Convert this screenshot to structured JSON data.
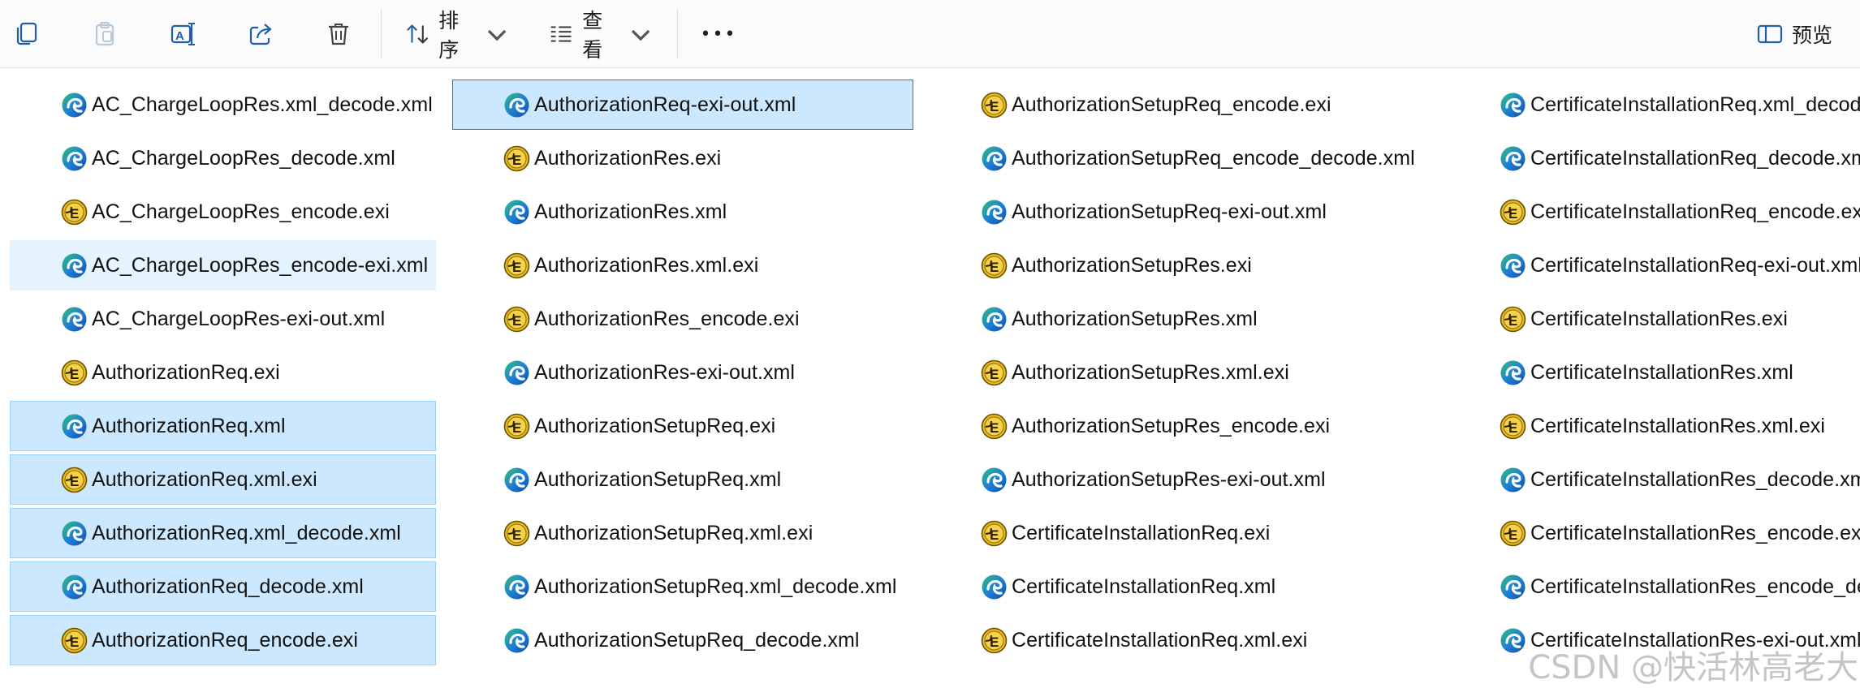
{
  "toolbar": {
    "icons": [
      "copy-icon",
      "paste-icon",
      "rename-icon",
      "share-icon",
      "delete-icon"
    ],
    "sort_label": "排序",
    "view_label": "查看",
    "more_label": "•••",
    "preview_label": "预览"
  },
  "files": {
    "col1": [
      {
        "name": "AC_ChargeLoopRes.xml_decode.xml",
        "type": "xml"
      },
      {
        "name": "AC_ChargeLoopRes_decode.xml",
        "type": "xml"
      },
      {
        "name": "AC_ChargeLoopRes_encode.exi",
        "type": "exi"
      },
      {
        "name": "AC_ChargeLoopRes_encode-exi.xml",
        "type": "xml"
      },
      {
        "name": "AC_ChargeLoopRes-exi-out.xml",
        "type": "xml"
      },
      {
        "name": "AuthorizationReq.exi",
        "type": "exi"
      },
      {
        "name": "AuthorizationReq.xml",
        "type": "xml"
      },
      {
        "name": "AuthorizationReq.xml.exi",
        "type": "exi"
      },
      {
        "name": "AuthorizationReq.xml_decode.xml",
        "type": "xml"
      },
      {
        "name": "AuthorizationReq_decode.xml",
        "type": "xml"
      },
      {
        "name": "AuthorizationReq_encode.exi",
        "type": "exi"
      }
    ],
    "col2": [
      {
        "name": "AuthorizationReq-exi-out.xml",
        "type": "xml"
      },
      {
        "name": "AuthorizationRes.exi",
        "type": "exi"
      },
      {
        "name": "AuthorizationRes.xml",
        "type": "xml"
      },
      {
        "name": "AuthorizationRes.xml.exi",
        "type": "exi"
      },
      {
        "name": "AuthorizationRes_encode.exi",
        "type": "exi"
      },
      {
        "name": "AuthorizationRes-exi-out.xml",
        "type": "xml"
      },
      {
        "name": "AuthorizationSetupReq.exi",
        "type": "exi"
      },
      {
        "name": "AuthorizationSetupReq.xml",
        "type": "xml"
      },
      {
        "name": "AuthorizationSetupReq.xml.exi",
        "type": "exi"
      },
      {
        "name": "AuthorizationSetupReq.xml_decode.xml",
        "type": "xml"
      },
      {
        "name": "AuthorizationSetupReq_decode.xml",
        "type": "xml"
      }
    ],
    "col3": [
      {
        "name": "AuthorizationSetupReq_encode.exi",
        "type": "exi"
      },
      {
        "name": "AuthorizationSetupReq_encode_decode.xml",
        "type": "xml"
      },
      {
        "name": "AuthorizationSetupReq-exi-out.xml",
        "type": "xml"
      },
      {
        "name": "AuthorizationSetupRes.exi",
        "type": "exi"
      },
      {
        "name": "AuthorizationSetupRes.xml",
        "type": "xml"
      },
      {
        "name": "AuthorizationSetupRes.xml.exi",
        "type": "exi"
      },
      {
        "name": "AuthorizationSetupRes_encode.exi",
        "type": "exi"
      },
      {
        "name": "AuthorizationSetupRes-exi-out.xml",
        "type": "xml"
      },
      {
        "name": "CertificateInstallationReq.exi",
        "type": "exi"
      },
      {
        "name": "CertificateInstallationReq.xml",
        "type": "xml"
      },
      {
        "name": "CertificateInstallationReq.xml.exi",
        "type": "exi"
      }
    ],
    "col4": [
      {
        "name": "CertificateInstallationReq.xml_decode.xml",
        "type": "xml"
      },
      {
        "name": "CertificateInstallationReq_decode.xml",
        "type": "xml"
      },
      {
        "name": "CertificateInstallationReq_encode.exi",
        "type": "exi"
      },
      {
        "name": "CertificateInstallationReq-exi-out.xml",
        "type": "xml"
      },
      {
        "name": "CertificateInstallationRes.exi",
        "type": "exi"
      },
      {
        "name": "CertificateInstallationRes.xml",
        "type": "xml"
      },
      {
        "name": "CertificateInstallationRes.xml.exi",
        "type": "exi"
      },
      {
        "name": "CertificateInstallationRes_decode.xml",
        "type": "xml"
      },
      {
        "name": "CertificateInstallationRes_encode.exi",
        "type": "exi"
      },
      {
        "name": "CertificateInstallationRes_encode_decode.xml",
        "type": "xml"
      },
      {
        "name": "CertificateInstallationRes-exi-out.xml",
        "type": "xml"
      }
    ]
  },
  "selection": {
    "selected_col1": [
      6,
      7,
      8,
      9,
      10
    ],
    "hover_col1": 3,
    "focused_col2": 0
  },
  "watermark": "CSDN @快活林高老大",
  "colors": {
    "selected_bg": "#cce8ff",
    "selected_border": "#99d1ff",
    "hover_bg": "#e5f3ff",
    "exi_icon": "#e8b923",
    "edge_icon_blue": "#1e7bd6",
    "edge_icon_green": "#2fc27d"
  }
}
